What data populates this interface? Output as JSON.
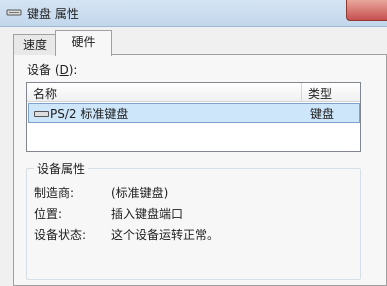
{
  "window": {
    "title": "键盘 属性",
    "icon": "keyboard-icon"
  },
  "tabs": [
    {
      "label": "速度",
      "active": false
    },
    {
      "label": "硬件",
      "active": true
    }
  ],
  "devices": {
    "label_prefix": "设备 (",
    "label_accel": "D",
    "label_suffix": "):",
    "columns": {
      "name": "名称",
      "type": "类型"
    },
    "rows": [
      {
        "name": "PS/2 标准键盘",
        "type": "键盘",
        "icon": "keyboard-icon",
        "selected": true
      }
    ]
  },
  "properties": {
    "title": "设备属性",
    "manufacturer_label": "制造商:",
    "manufacturer_value": "(标准键盘)",
    "location_label": "位置:",
    "location_value": "插入键盘端口",
    "status_label": "设备状态:",
    "status_value": "这个设备运转正常。"
  }
}
